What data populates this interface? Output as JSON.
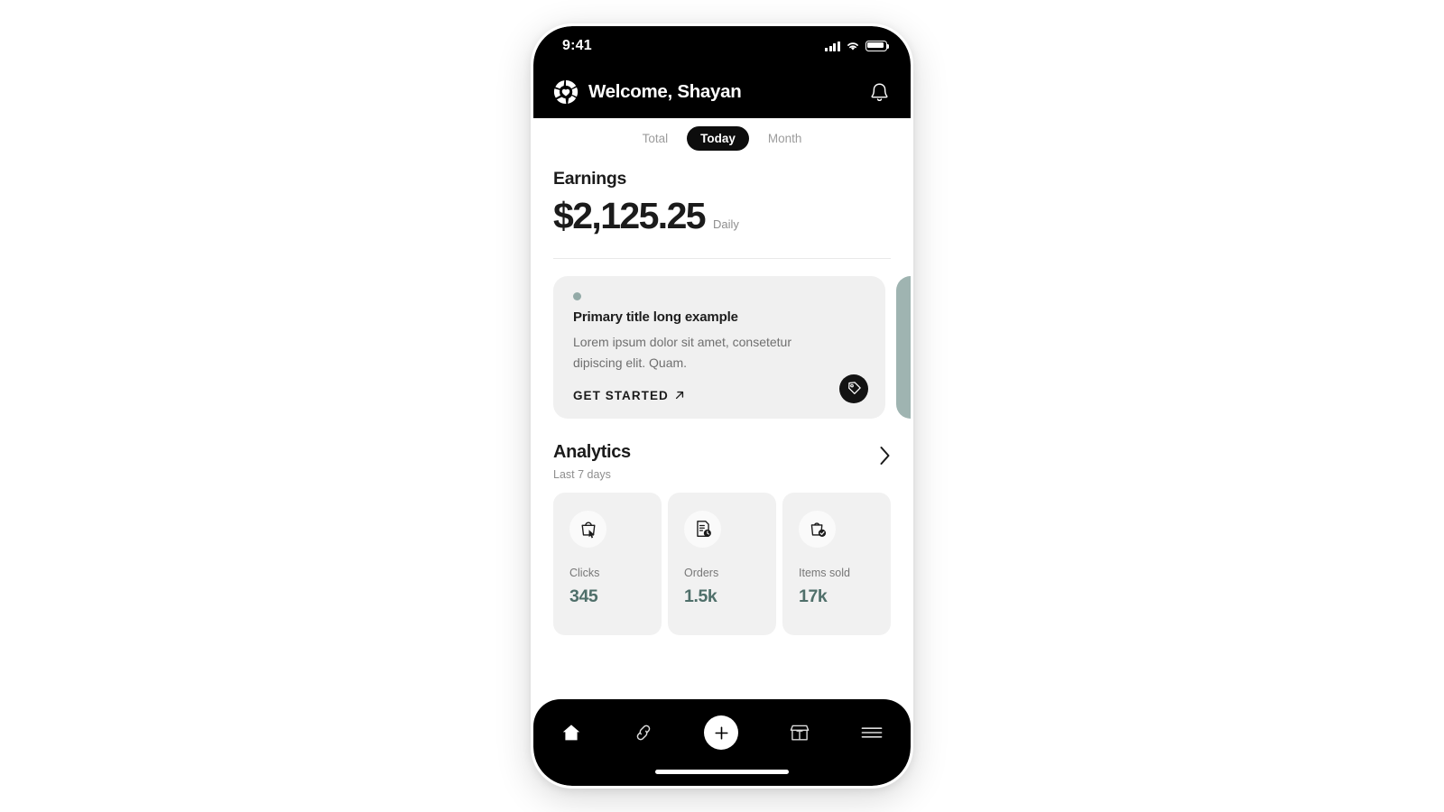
{
  "status_bar": {
    "time": "9:41",
    "icons": [
      "cellular-signal-icon",
      "wifi-icon",
      "battery-icon"
    ]
  },
  "header": {
    "logo_icon": "aperture-heart-logo-icon",
    "greeting": "Welcome, Shayan",
    "notification_icon": "bell-icon"
  },
  "tabs": [
    {
      "label": "Total",
      "active": false
    },
    {
      "label": "Today",
      "active": true
    },
    {
      "label": "Month",
      "active": false
    }
  ],
  "earnings": {
    "label": "Earnings",
    "amount": "$2,125.25",
    "period": "Daily"
  },
  "promo_card": {
    "dot_color": "#93aaa7",
    "title": "Primary title long example",
    "description": "Lorem ipsum dolor sit amet, consetetur dipiscing elit. Quam.",
    "cta_label": "GET STARTED",
    "cta_icon": "arrow-up-right-icon",
    "badge_icon": "price-tag-icon",
    "peek_card_color": "#9fb4b1"
  },
  "analytics": {
    "title": "Analytics",
    "subtitle": "Last 7 days",
    "chevron_icon": "chevron-right-icon",
    "stats": [
      {
        "icon": "shopping-bag-cursor-icon",
        "label": "Clicks",
        "value": "345"
      },
      {
        "icon": "document-clock-icon",
        "label": "Orders",
        "value": "1.5k"
      },
      {
        "icon": "shopping-bag-check-icon",
        "label": "Items sold",
        "value": "17k"
      }
    ],
    "value_color": "#4f6f6a"
  },
  "bottom_nav": [
    {
      "icon": "home-icon",
      "active": true
    },
    {
      "icon": "link-icon",
      "active": false
    },
    {
      "icon": "plus-icon",
      "active": false
    },
    {
      "icon": "storefront-icon",
      "active": false
    },
    {
      "icon": "hamburger-menu-icon",
      "active": false
    }
  ]
}
